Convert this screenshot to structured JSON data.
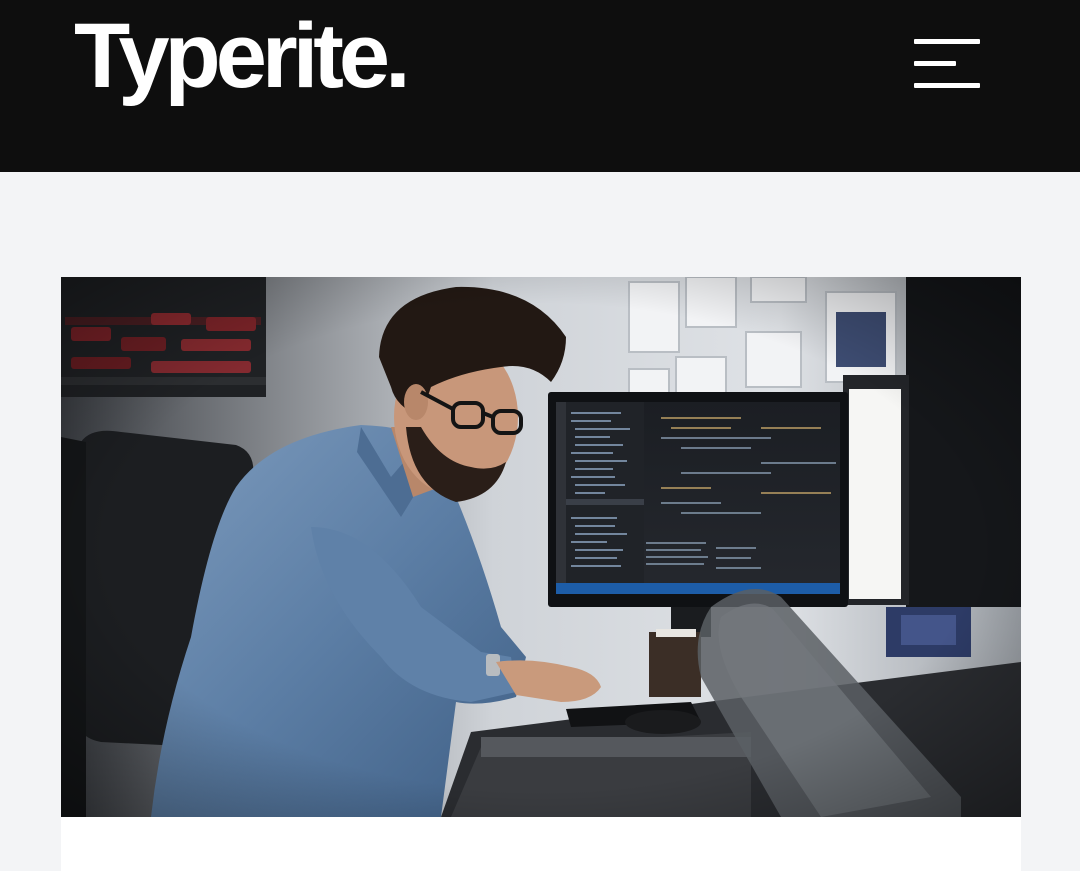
{
  "header": {
    "logo_text": "Typerite.",
    "menu_icon": "hamburger-menu-icon"
  },
  "post": {
    "featured_image": "developer-at-workstation-photo"
  },
  "colors": {
    "header_bg": "#0e0e0e",
    "page_bg": "#f3f4f6",
    "card_bg": "#ffffff",
    "logo": "#ffffff"
  }
}
